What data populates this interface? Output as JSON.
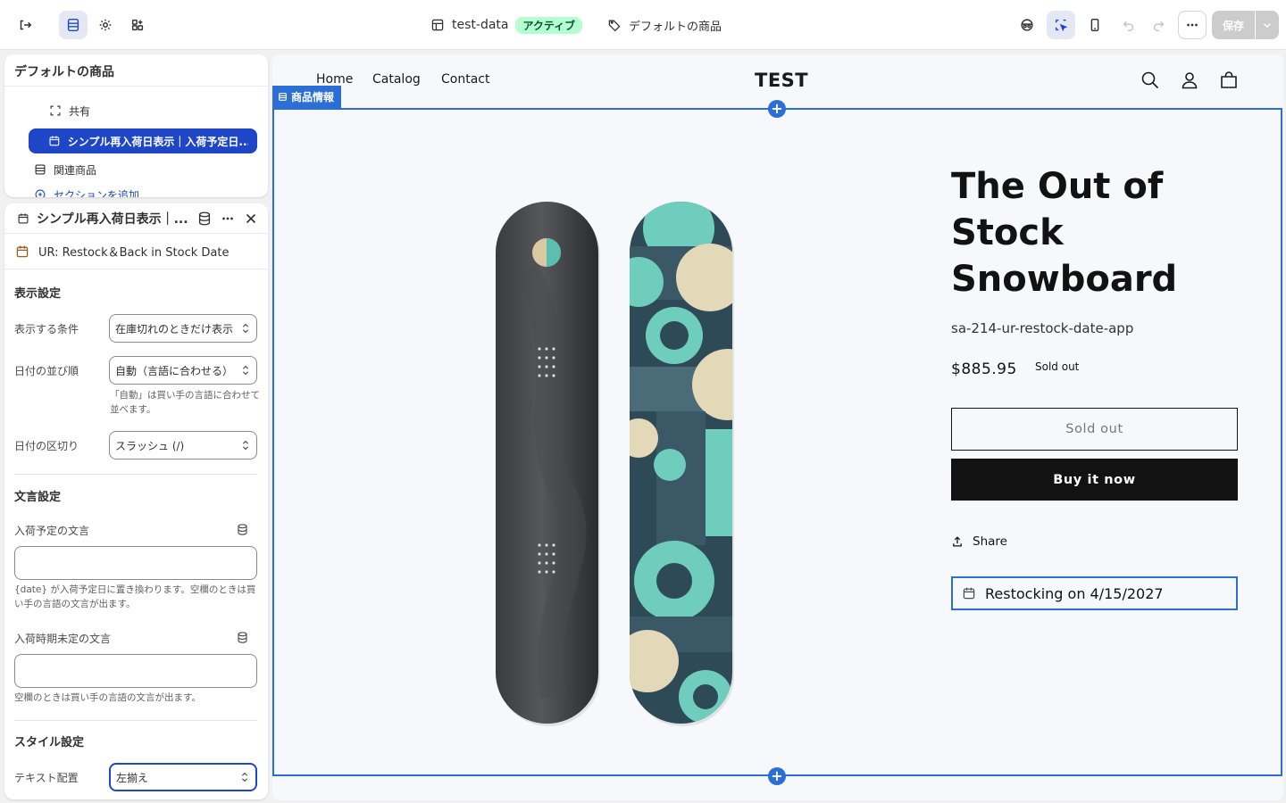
{
  "topbar": {
    "theme_name": "test-data",
    "theme_status": "アクティブ",
    "template_name": "デフォルトの商品",
    "save_label": "保存"
  },
  "sidebar_tree": {
    "title": "デフォルトの商品",
    "items": [
      {
        "label": "共有"
      },
      {
        "label": "シンプル再入荷日表示｜入荷予定日..."
      },
      {
        "label": "関連商品"
      },
      {
        "label": "セクションを追加"
      }
    ]
  },
  "settings_panel": {
    "title": "シンプル再入荷日表示｜...",
    "app_name": "UR: Restock＆Back in Stock Date",
    "display_section": "表示設定",
    "condition_label": "表示する条件",
    "condition_value": "在庫切れのときだけ表示",
    "date_order_label": "日付の並び順",
    "date_order_value": "自動（言語に合わせる）",
    "date_order_help": "「自動」は買い手の言語に合わせて並べます。",
    "separator_label": "日付の区切り",
    "separator_value": "スラッシュ (/)",
    "text_section": "文言設定",
    "expected_text_label": "入荷予定の文言",
    "expected_text_value": "",
    "expected_text_help": "{date} が入荷予定日に置き換わります。空欄のときは買い手の言語の文言が出ます。",
    "undecided_text_label": "入荷時期未定の文言",
    "undecided_text_value": "",
    "undecided_text_help": "空欄のときは買い手の言語の文言が出ます。",
    "style_section": "スタイル設定",
    "alignment_label": "テキスト配置",
    "alignment_value": "左揃え"
  },
  "store": {
    "nav": [
      "Home",
      "Catalog",
      "Contact"
    ],
    "logo": "TEST",
    "section_tag": "商品情報",
    "product_title": "The Out of Stock Snowboard",
    "sku": "sa-214-ur-restock-date-app",
    "price": "$885.95",
    "sold_tag": "Sold out",
    "soldout_button": "Sold out",
    "buy_button": "Buy it now",
    "share": "Share",
    "restock_text": "Restocking on 4/15/2027"
  },
  "colors": {
    "accent_blue": "#2046c8",
    "frame_blue": "#2b6fd6",
    "badge_green": "#b4fed2"
  }
}
